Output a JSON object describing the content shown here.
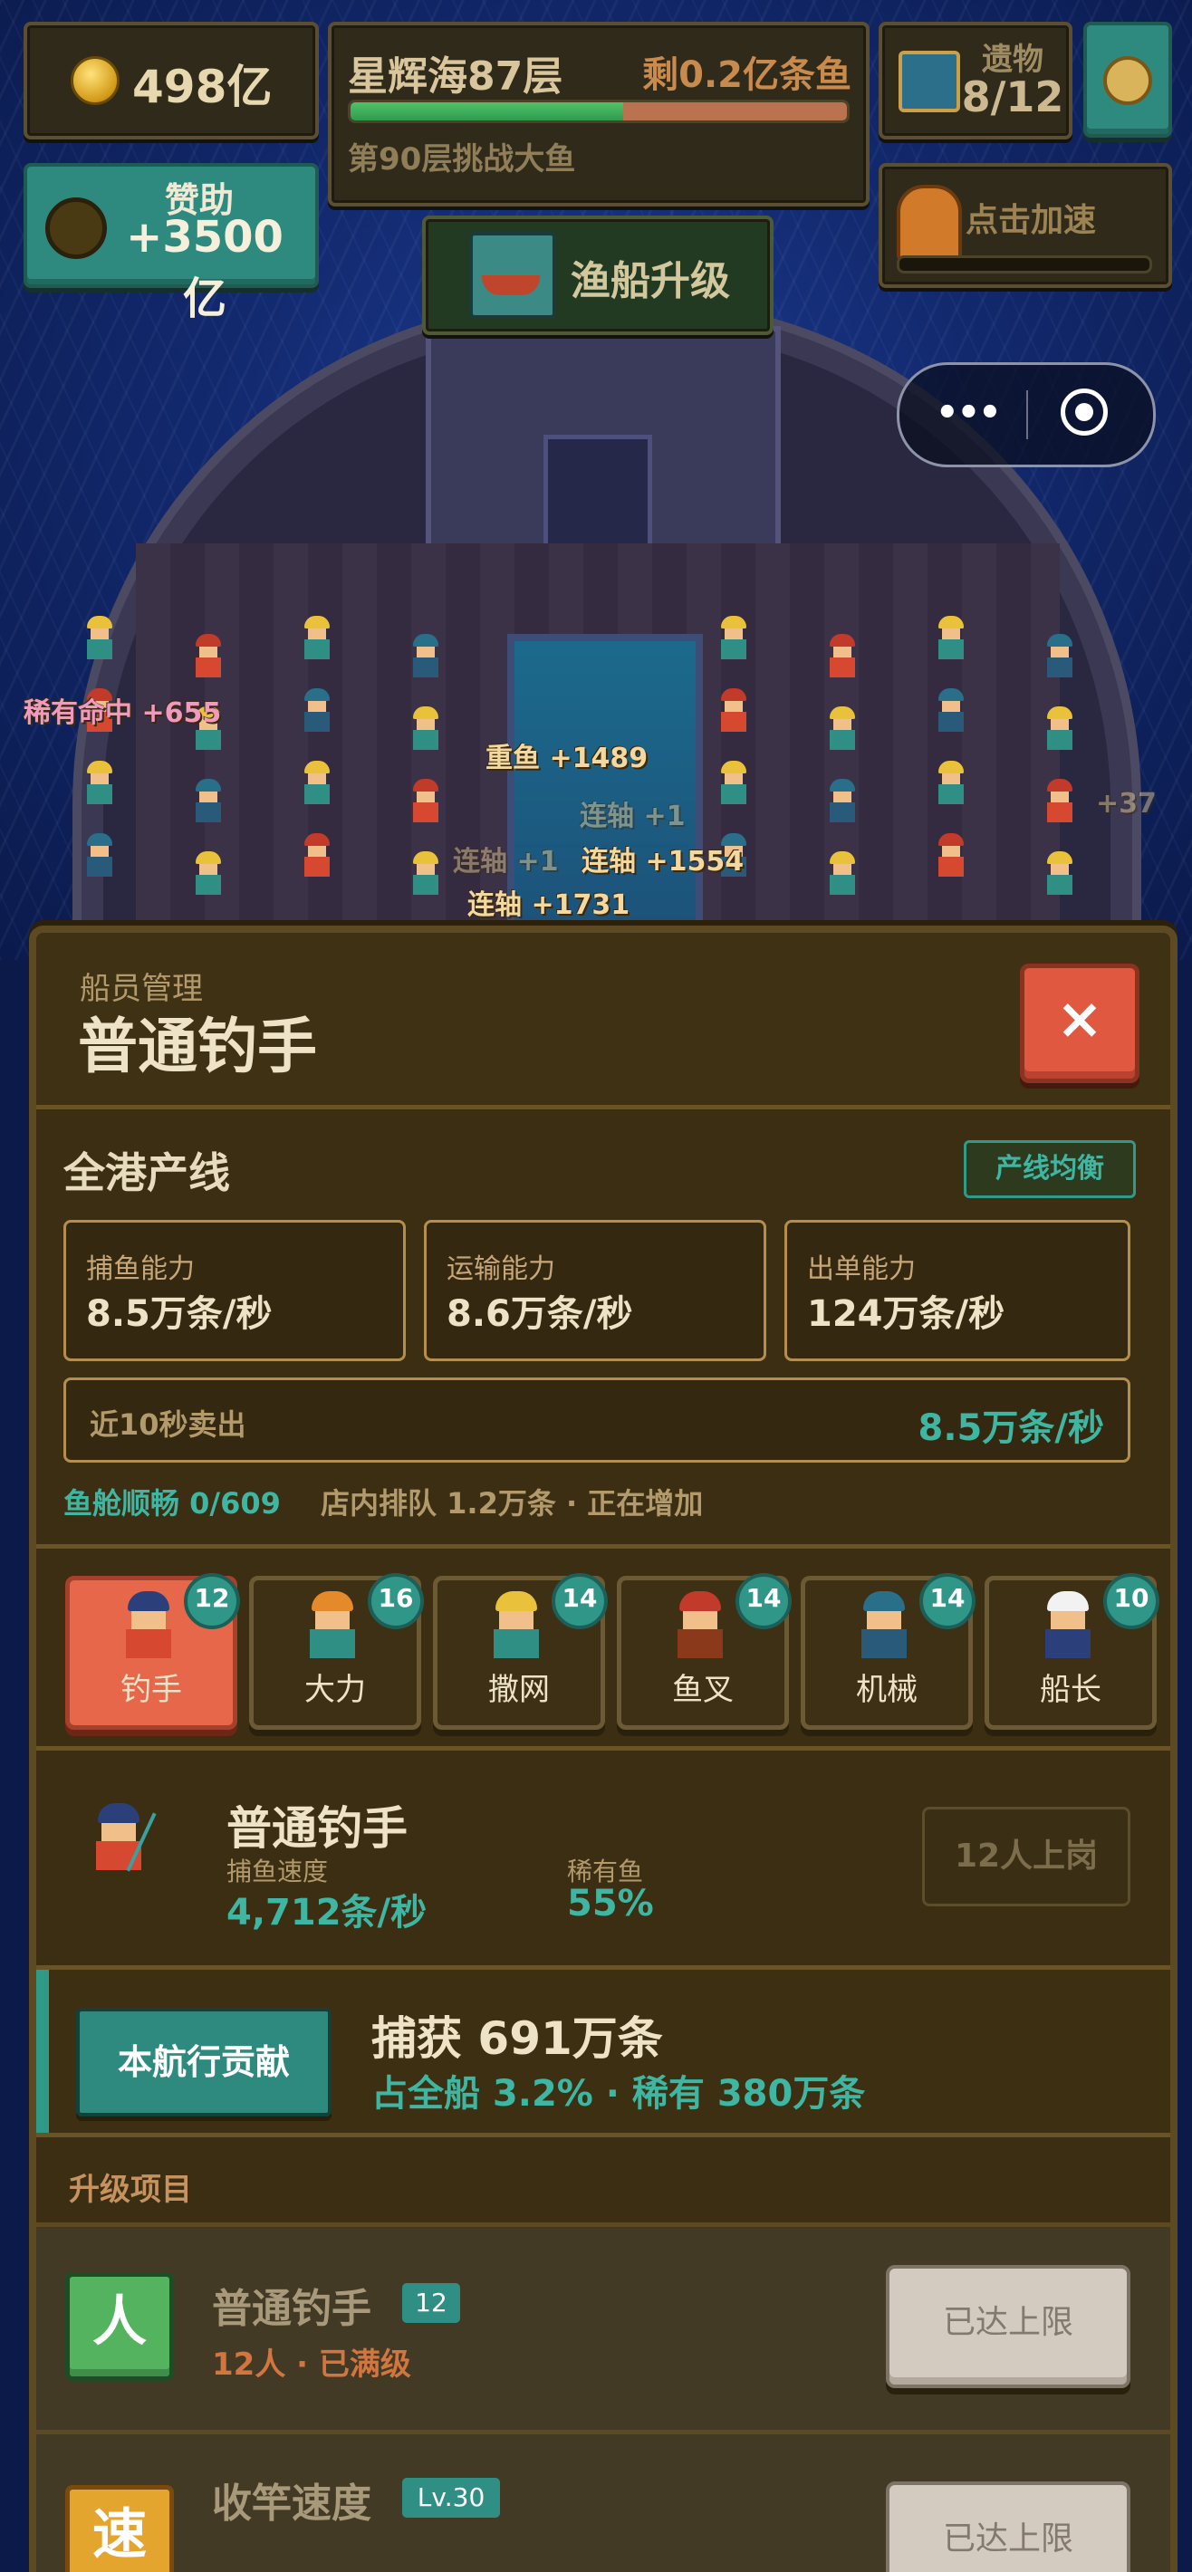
{
  "hud": {
    "coins": "498亿",
    "stage_title": "星辉海87层",
    "stage_remaining": "剩0.2亿条鱼",
    "stage_progress": 0.55,
    "stage_next": "第90层挑战大鱼",
    "relics_label": "遗物",
    "relics_count": "8/12",
    "sponsor_label": "赞助",
    "sponsor_amount": "+3500亿",
    "speedup_label": "点击加速",
    "boat_upgrade_label": "渔船升级",
    "menu_dots": "•••"
  },
  "floating_texts": {
    "rare_hit": "稀有命中 +655",
    "heavy_fish": "重鱼 +1489",
    "combo_1": "连轴 +1554",
    "combo_2": "连轴 +1731",
    "combo_3": "连轴 +1554",
    "combo_4": "连轴 +1",
    "combo_5": "连轴 +1",
    "combo_6": "+37"
  },
  "panel": {
    "subtitle": "船员管理",
    "title": "普通钓手",
    "close_label": "×",
    "production": {
      "title": "全港产线",
      "status_tag": "产线均衡",
      "stats": [
        {
          "label": "捕鱼能力",
          "value": "8.5万条/秒"
        },
        {
          "label": "运输能力",
          "value": "8.6万条/秒"
        },
        {
          "label": "出单能力",
          "value": "124万条/秒"
        }
      ],
      "recent_label": "近10秒卖出",
      "recent_value": "8.5万条/秒",
      "hold_status": "鱼舱顺畅 0/609",
      "queue_status": "店内排队 1.2万条 · 正在增加"
    },
    "tabs": [
      {
        "label": "钓手",
        "count": "12"
      },
      {
        "label": "大力",
        "count": "16"
      },
      {
        "label": "撒网",
        "count": "14"
      },
      {
        "label": "鱼叉",
        "count": "14"
      },
      {
        "label": "机械",
        "count": "14"
      },
      {
        "label": "船长",
        "count": "10"
      }
    ],
    "worker": {
      "name": "普通钓手",
      "speed_label": "捕鱼速度",
      "speed_value": "4,712条/秒",
      "rare_label": "稀有鱼",
      "rare_value": "55%",
      "assign_button": "12人上岗"
    },
    "contribution": {
      "button": "本航行贡献",
      "catch": "捕获 691万条",
      "detail": "占全船 3.2% · 稀有 380万条"
    },
    "upgrades": {
      "section_title": "升级项目",
      "items": [
        {
          "icon_char": "人",
          "name": "普通钓手",
          "level": "12",
          "sub": "12人 · 已满级",
          "button": "已达上限"
        },
        {
          "icon_char": "速",
          "name": "收竿速度",
          "level": "Lv.30",
          "sub": "",
          "button": "已达上限"
        }
      ]
    }
  },
  "colors": {
    "accent_teal": "#2f9a88",
    "accent_red": "#e7674b",
    "panel_bg": "#3b2e12",
    "text_cream": "#efe3c7"
  }
}
